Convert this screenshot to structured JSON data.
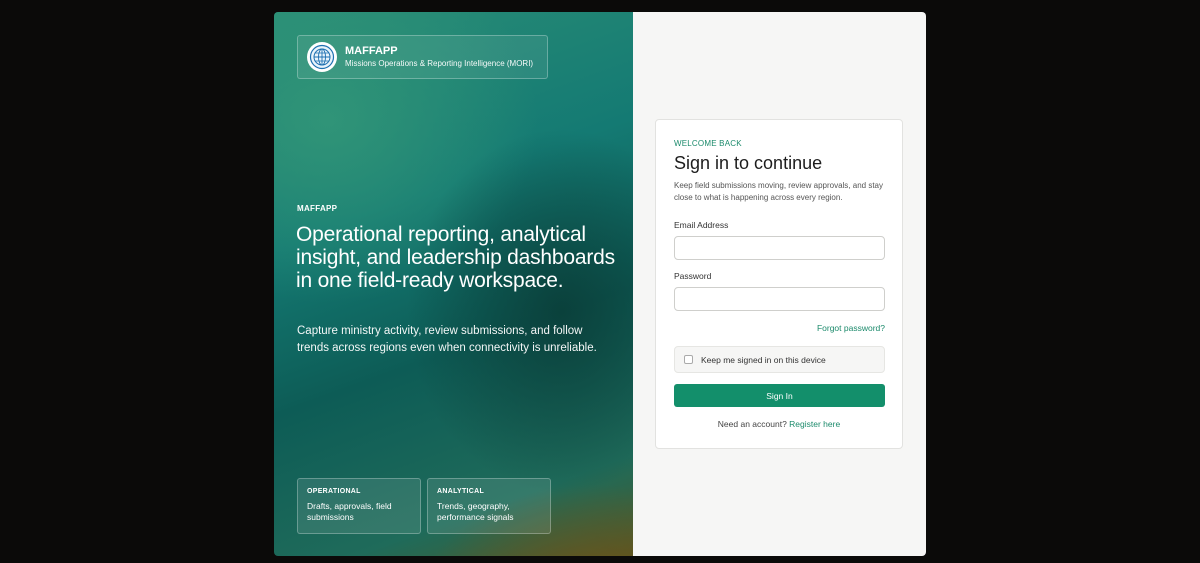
{
  "brand": {
    "name": "MAFFAPP",
    "subtitle": "Missions Operations & Reporting Intelligence (MORI)"
  },
  "hero": {
    "eyebrow": "MAFFAPP",
    "headline": "Operational reporting, analytical insight, and leadership dashboards in one field-ready workspace.",
    "lede": "Capture ministry activity, review submissions, and follow trends across regions even when connectivity is unreliable.",
    "tiles": [
      {
        "title": "OPERATIONAL",
        "body": "Drafts, approvals, field submissions"
      },
      {
        "title": "ANALYTICAL",
        "body": "Trends, geography, performance signals"
      }
    ]
  },
  "login": {
    "kicker": "WELCOME BACK",
    "title": "Sign in to continue",
    "description": "Keep field submissions moving, review approvals, and stay close to what is happening across every region.",
    "email_label": "Email Address",
    "email_value": "",
    "password_label": "Password",
    "password_value": "",
    "forgot_label": "Forgot password?",
    "remember_label": "Keep me signed in on this device",
    "submit_label": "Sign In",
    "register_prompt": "Need an account?",
    "register_label": "Register here"
  },
  "icons": {
    "logo": "globe-icon"
  },
  "colors": {
    "accent": "#138f6b",
    "accent_text": "#1b8a6b",
    "page_bg": "#0b0a09"
  }
}
